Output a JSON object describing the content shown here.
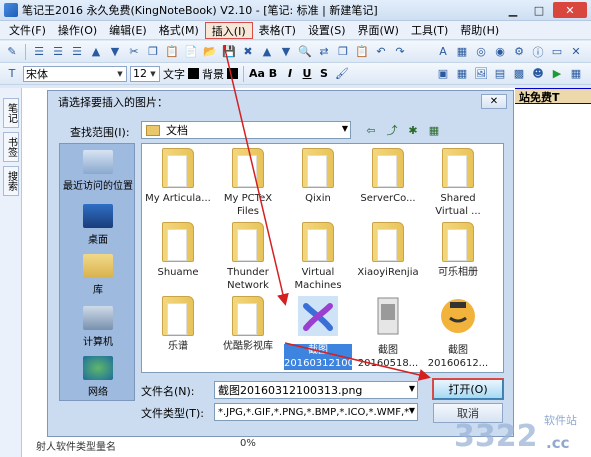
{
  "window": {
    "title": "笔记王2016 永久免费(KingNoteBook) V2.10 - [笔记: 标准 | 新建笔记]"
  },
  "menu": [
    {
      "label": "文件(F)"
    },
    {
      "label": "操作(O)"
    },
    {
      "label": "编辑(E)"
    },
    {
      "label": "格式(M)"
    },
    {
      "label": "插入(I)"
    },
    {
      "label": "表格(T)"
    },
    {
      "label": "设置(S)"
    },
    {
      "label": "界面(W)"
    },
    {
      "label": "工具(T)"
    },
    {
      "label": "帮助(H)"
    }
  ],
  "format_bar": {
    "font": "宋体",
    "size": "12",
    "text_color_label": "文字",
    "bg_color_label": "背景",
    "text_color": "#000000",
    "bg_color": "#000000"
  },
  "side_tabs": [
    "笔记",
    "书签",
    "搜索"
  ],
  "background": {
    "banner": "站免费T",
    "bottom_text": "射人软件类型量名",
    "bottom_pct": "0%"
  },
  "dialog": {
    "title": "请选择要插入的图片：",
    "look_in_label": "查找范围(I):",
    "look_in_value": "文档",
    "places": [
      {
        "label": "最近访问的位置",
        "icon": "recent-places-icon"
      },
      {
        "label": "桌面",
        "icon": "desktop-icon"
      },
      {
        "label": "库",
        "icon": "libraries-icon"
      },
      {
        "label": "计算机",
        "icon": "computer-icon"
      },
      {
        "label": "网络",
        "icon": "network-icon"
      }
    ],
    "files": [
      {
        "name": "My Articula...",
        "kind": "folder"
      },
      {
        "name": "My PCTeX Files",
        "kind": "folder"
      },
      {
        "name": "Qixin",
        "kind": "folder"
      },
      {
        "name": "ServerCo...",
        "kind": "folder"
      },
      {
        "name": "Shared Virtual ...",
        "kind": "folder"
      },
      {
        "name": "Shuame",
        "kind": "folder"
      },
      {
        "name": "Thunder Network",
        "kind": "folder"
      },
      {
        "name": "Virtual Machines",
        "kind": "folder"
      },
      {
        "name": "XiaoyiRenjia",
        "kind": "folder"
      },
      {
        "name": "可乐相册",
        "kind": "folder"
      },
      {
        "name": "乐谱",
        "kind": "folder"
      },
      {
        "name": "优酷影视库",
        "kind": "folder"
      },
      {
        "name": "截图 20160312100313.png",
        "kind": "image",
        "selected": true
      },
      {
        "name": "截图 20160518...",
        "kind": "image"
      },
      {
        "name": "截图 20160612...",
        "kind": "image"
      }
    ],
    "file_name_label": "文件名(N):",
    "file_name_value": "截图20160312100313.png",
    "file_type_label": "文件类型(T):",
    "file_type_value": "*.JPG,*.GIF,*.PNG,*.BMP,*.ICO,*.WMF,*",
    "open_label": "打开(O)",
    "cancel_label": "取消"
  },
  "watermark": {
    "text": "3322",
    "sub": "软件站",
    "suffix": ".cc"
  },
  "colors": {
    "accent": "#3d83e0",
    "highlight": "#d84c4c",
    "arrow": "#d42020"
  }
}
